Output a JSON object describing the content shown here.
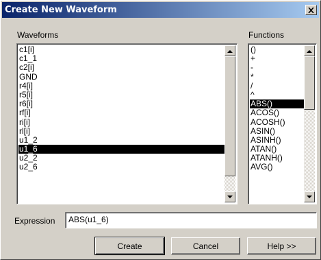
{
  "window": {
    "title": "Create New Waveform"
  },
  "icons": {
    "close": "close-icon",
    "up": "arrow-up-icon",
    "down": "arrow-down-icon"
  },
  "waveforms": {
    "label": "Waveforms",
    "items": [
      "c1[i]",
      "c1_1",
      "c2[i]",
      "GND",
      "r4[i]",
      "r5[i]",
      "r6[i]",
      "rf[i]",
      "ri[i]",
      "rl[i]",
      "u1_2",
      "u1_6",
      "u2_2",
      "u2_6"
    ],
    "selected_index": 11
  },
  "functions": {
    "label": "Functions",
    "items": [
      "()",
      "+",
      "-",
      "*",
      "/",
      "^",
      "ABS()",
      "ACOS()",
      "ACOSH()",
      "ASIN()",
      "ASINH()",
      "ATAN()",
      "ATANH()",
      "AVG()"
    ],
    "selected_index": 6
  },
  "expression": {
    "label": "Expression",
    "value": "ABS(u1_6)"
  },
  "buttons": {
    "create": "Create",
    "cancel": "Cancel",
    "help": "Help >>"
  }
}
